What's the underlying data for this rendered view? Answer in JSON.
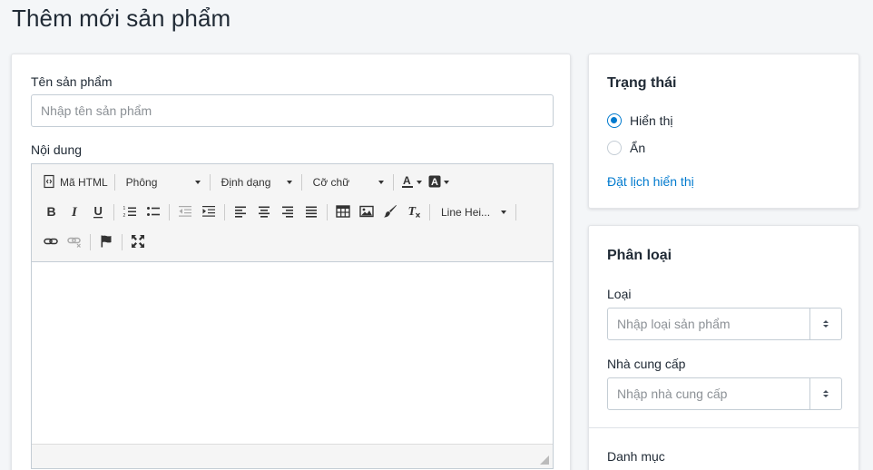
{
  "page": {
    "title": "Thêm mới sản phẩm"
  },
  "product_form": {
    "name_label": "Tên sản phẩm",
    "name_placeholder": "Nhập tên sản phẩm",
    "content_label": "Nội dung"
  },
  "editor": {
    "toolbar": {
      "html_button": "Mã HTML",
      "font_dropdown": "Phông",
      "format_dropdown": "Định dạng",
      "size_dropdown": "Cỡ chữ",
      "line_height_dropdown": "Line Hei...",
      "icons": [
        "code-icon",
        "font-color-icon",
        "background-color-icon",
        "bold-icon",
        "italic-icon",
        "underline-icon",
        "ordered-list-icon",
        "unordered-list-icon",
        "outdent-icon",
        "indent-icon",
        "align-left-icon",
        "align-center-icon",
        "align-right-icon",
        "justify-icon",
        "table-icon",
        "image-icon",
        "paint-brush-icon",
        "clear-format-icon",
        "link-icon",
        "unlink-icon",
        "flag-icon",
        "fullscreen-icon"
      ]
    }
  },
  "status": {
    "title": "Trạng thái",
    "options": [
      "Hiển thị",
      "Ẩn"
    ],
    "selected": "Hiển thị",
    "schedule_link": "Đặt lịch hiển thị",
    "accent_color": "#007ace"
  },
  "classification": {
    "title": "Phân loại",
    "type_label": "Loại",
    "type_placeholder": "Nhập loại sản phẩm",
    "vendor_label": "Nhà cung cấp",
    "vendor_placeholder": "Nhập nhà cung cấp",
    "category_label": "Danh mục"
  }
}
